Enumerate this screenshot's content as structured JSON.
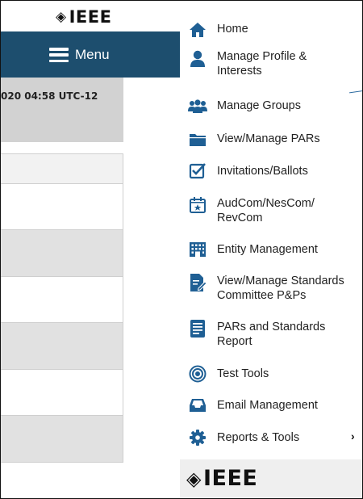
{
  "background_page": {
    "logo_text": "IEEE",
    "menu_label": "Menu",
    "timestamp": "020  04:58 UTC-12"
  },
  "side_menu": {
    "items": [
      {
        "label_lines": [
          "Home"
        ],
        "icon": "home-icon"
      },
      {
        "label_lines": [
          "Manage Profile &",
          "Interests"
        ],
        "icon": "user-icon"
      },
      {
        "label_lines": [
          "Manage Groups"
        ],
        "icon": "users-group-icon"
      },
      {
        "label_lines": [
          "View/Manage PARs"
        ],
        "icon": "folder-icon"
      },
      {
        "label_lines": [
          "Invitations/Ballots"
        ],
        "icon": "checkbox-icon"
      },
      {
        "label_lines": [
          "AudCom/NesCom/",
          "RevCom"
        ],
        "icon": "calendar-star-icon"
      },
      {
        "label_lines": [
          "Entity Management"
        ],
        "icon": "building-icon"
      },
      {
        "label_lines": [
          "View/Manage Standards",
          "Committee P&Ps"
        ],
        "icon": "document-edit-icon"
      },
      {
        "label_lines": [
          "PARs and Standards",
          "Report"
        ],
        "icon": "report-icon"
      },
      {
        "label_lines": [
          "Test Tools"
        ],
        "icon": "target-icon"
      },
      {
        "label_lines": [
          "Email Management"
        ],
        "icon": "inbox-icon"
      },
      {
        "label_lines": [
          "Reports & Tools"
        ],
        "icon": "gear-icon",
        "chevron": "›"
      }
    ],
    "footer_logo_text": "IEEE"
  },
  "colors": {
    "navbar": "#1d4e6e",
    "icon_blue": "#1f5f94"
  }
}
